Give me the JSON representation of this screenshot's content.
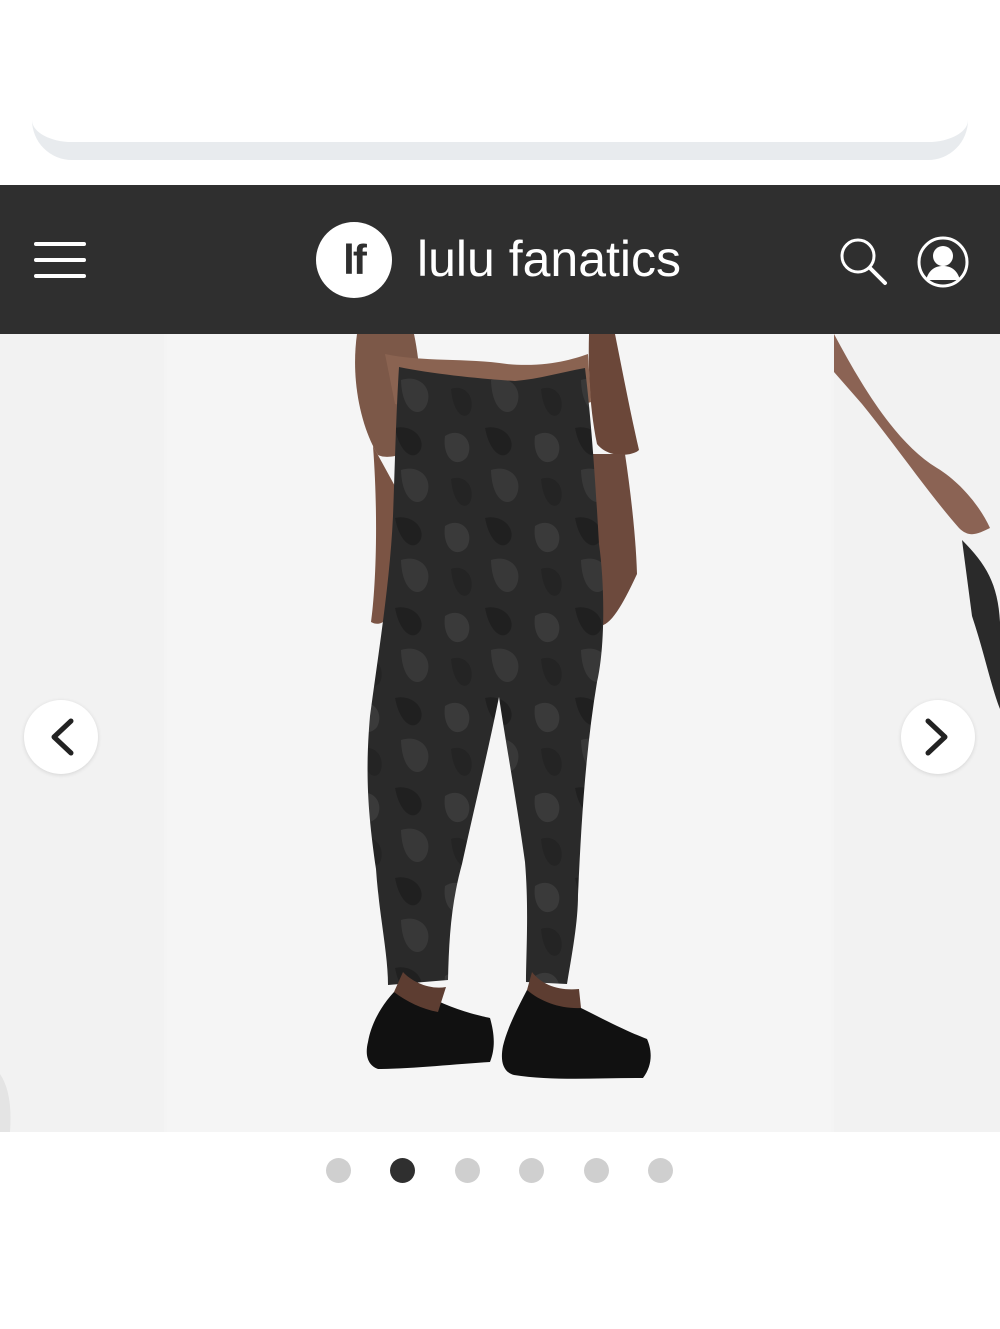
{
  "header": {
    "logo_text": "lf",
    "brand_name": "lulu fanatics"
  },
  "gallery": {
    "image_subject": "back view of model wearing high-rise black camo leggings with black sneakers",
    "slide_count": 6,
    "active_slide_index": 1
  },
  "colors": {
    "header_bg": "#2f2f2f",
    "dot_active": "#2f2f2f",
    "dot_inactive": "#cfcfcf"
  }
}
